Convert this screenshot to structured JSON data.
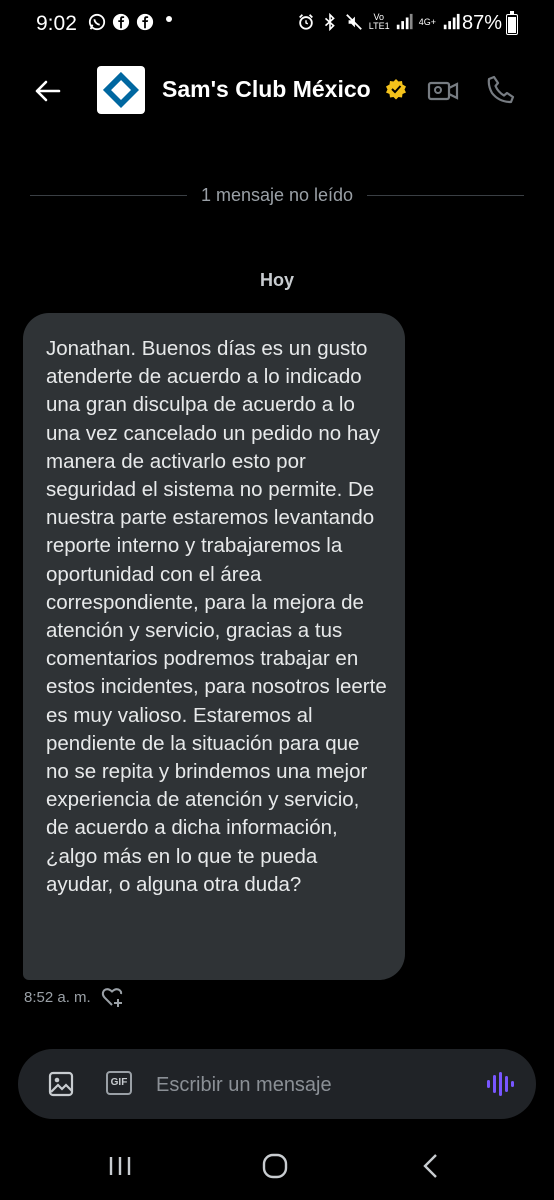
{
  "status_bar": {
    "time": "9:02",
    "battery": "87%",
    "network_label": "4G+",
    "volte_label": "Vo LTE1"
  },
  "header": {
    "title": "Sam's Club México",
    "accent_color": "#f4c21b"
  },
  "conversation": {
    "unread_divider": "1 mensaje no leído",
    "day_label": "Hoy",
    "messages": [
      {
        "text": "Jonathan. Buenos días es un gusto atenderte de acuerdo a lo indicado una gran disculpa de acuerdo a lo una vez cancelado un pedido no hay manera de activarlo esto por seguridad el sistema no permite. De nuestra parte estaremos levantando reporte interno y trabajaremos la oportunidad con el área correspondiente, para la mejora de atención y servicio, gracias a tus comentarios podremos trabajar en estos incidentes, para nosotros leerte es muy valioso. Estaremos al pendiente de la situación para que no se repita y brindemos una mejor experiencia de atención y servicio, de acuerdo a dicha información, ¿algo más en lo que te pueda ayudar, o alguna otra duda?",
        "time": "8:52 a. m."
      }
    ]
  },
  "composer": {
    "placeholder": "Escribir un mensaje",
    "gif_label": "GIF",
    "voice_color": "#7856ff"
  },
  "icons": {
    "back": "arrow-left-icon",
    "video": "video-call-icon",
    "phone": "phone-icon",
    "image": "image-icon",
    "react": "heart-plus-icon",
    "voice": "voice-wave-icon"
  }
}
